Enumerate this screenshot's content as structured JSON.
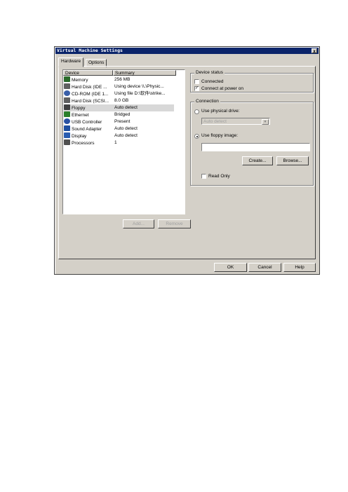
{
  "window": {
    "title": "Virtual Machine Settings",
    "close_label": "x"
  },
  "tabs": [
    {
      "label": "Hardware"
    },
    {
      "label": "Options"
    }
  ],
  "device_list": {
    "columns": [
      "Device",
      "Summary"
    ],
    "rows": [
      {
        "device": "Memory",
        "summary": "256 MB",
        "icon": "memory-icon"
      },
      {
        "device": "Hard Disk (IDE ...",
        "summary": "Using device \\\\.\\Physic...",
        "icon": "hard-disk-icon"
      },
      {
        "device": "CD-ROM (IDE 1...",
        "summary": "Using file D:\\软件\\strike...",
        "icon": "cdrom-icon"
      },
      {
        "device": "Hard Disk (SCSI...",
        "summary": "8.0 GB",
        "icon": "hard-disk-icon"
      },
      {
        "device": "Floppy",
        "summary": "Auto detect",
        "icon": "floppy-icon",
        "selected": true
      },
      {
        "device": "Ethernet",
        "summary": "Bridged",
        "icon": "ethernet-icon"
      },
      {
        "device": "USB Controller",
        "summary": "Present",
        "icon": "usb-icon"
      },
      {
        "device": "Sound Adapter",
        "summary": "Auto detect",
        "icon": "sound-icon"
      },
      {
        "device": "Display",
        "summary": "Auto detect",
        "icon": "display-icon"
      },
      {
        "device": "Processors",
        "summary": "1",
        "icon": "processor-icon"
      }
    ]
  },
  "list_buttons": {
    "add": "Add...",
    "remove": "Remove"
  },
  "device_status": {
    "title": "Device status",
    "connected": {
      "label": "Connected",
      "checked": false
    },
    "connect_at_power_on": {
      "label": "Connect at power on",
      "checked": true
    }
  },
  "connection": {
    "title": "Connection",
    "use_physical_drive": {
      "label": "Use physical drive:",
      "selected": false
    },
    "physical_drive_select": "Auto detect",
    "use_floppy_image": {
      "label": "Use floppy image:",
      "selected": true
    },
    "floppy_image_value": "",
    "create_button": "Create...",
    "browse_button": "Browse...",
    "read_only": {
      "label": "Read Only",
      "checked": false
    }
  },
  "footer": {
    "ok": "OK",
    "cancel": "Cancel",
    "help": "Help"
  }
}
